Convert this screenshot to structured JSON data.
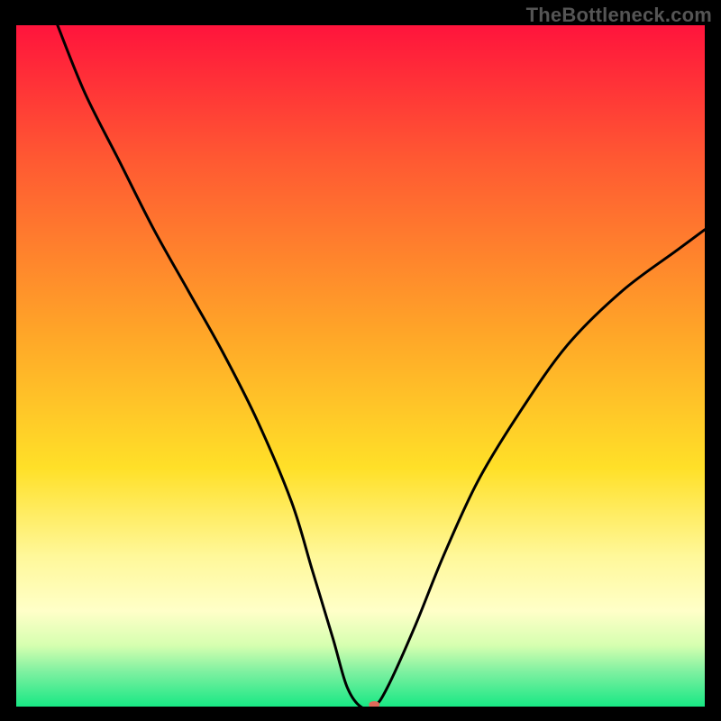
{
  "watermark": "TheBottleneck.com",
  "chart_data": {
    "type": "line",
    "title": "",
    "xlabel": "",
    "ylabel": "",
    "xlim": [
      0,
      100
    ],
    "ylim": [
      0,
      100
    ],
    "background_gradient": {
      "stops": [
        {
          "offset": 0,
          "color": "#ff143c"
        },
        {
          "offset": 20,
          "color": "#ff5a32"
        },
        {
          "offset": 45,
          "color": "#ffa528"
        },
        {
          "offset": 65,
          "color": "#ffe028"
        },
        {
          "offset": 78,
          "color": "#fff89a"
        },
        {
          "offset": 86,
          "color": "#ffffc8"
        },
        {
          "offset": 91,
          "color": "#d6ffb0"
        },
        {
          "offset": 95,
          "color": "#7cf0a0"
        },
        {
          "offset": 100,
          "color": "#18e884"
        }
      ]
    },
    "series": [
      {
        "name": "bottleneck-curve",
        "x": [
          6,
          10,
          15,
          20,
          25,
          30,
          35,
          40,
          43,
          46,
          48,
          50,
          52,
          54,
          58,
          62,
          67,
          73,
          80,
          88,
          96,
          100
        ],
        "y": [
          100,
          90,
          80,
          70,
          61,
          52,
          42,
          30,
          20,
          10,
          3,
          0,
          0,
          3,
          12,
          22,
          33,
          43,
          53,
          61,
          67,
          70
        ]
      }
    ],
    "marker": {
      "x": 52,
      "y": 0,
      "color": "#e06a5a",
      "rx": 6,
      "ry": 4
    }
  }
}
